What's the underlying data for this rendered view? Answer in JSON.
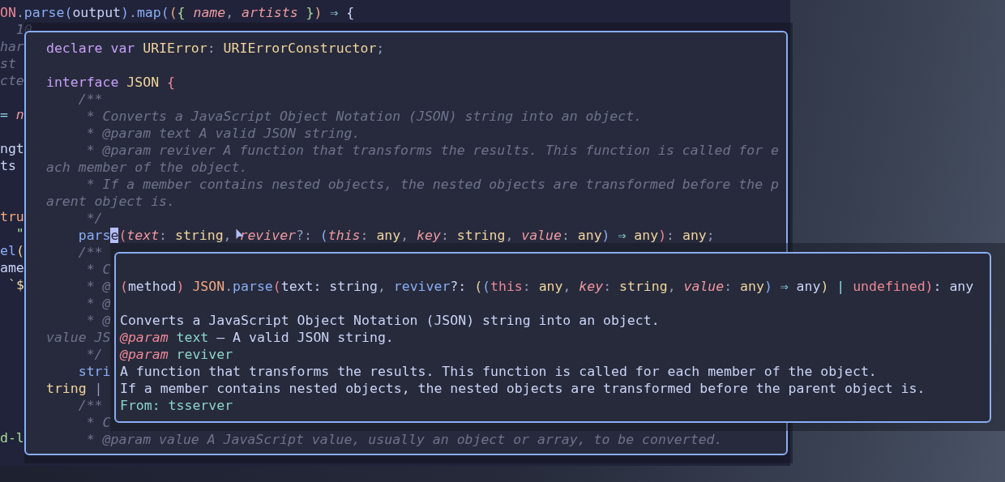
{
  "editor": {
    "lines": [
      {
        "tokens": [
          {
            "kind": "err",
            "text": "ON"
          },
          {
            "kind": "punct",
            "text": "."
          },
          {
            "kind": "fn",
            "text": "parse"
          },
          {
            "kind": "paren",
            "text": "("
          },
          {
            "kind": "text",
            "text": "output"
          },
          {
            "kind": "paren",
            "text": ")"
          },
          {
            "kind": "punct",
            "text": "."
          },
          {
            "kind": "fn",
            "text": "map"
          },
          {
            "kind": "paren",
            "text": "("
          },
          {
            "kind": "peach",
            "text": "("
          },
          {
            "kind": "green",
            "text": "{"
          },
          {
            "kind": "param",
            "text": " name"
          },
          {
            "kind": "punct",
            "text": ","
          },
          {
            "kind": "param",
            "text": " artists"
          },
          {
            "kind": "green",
            "text": " }"
          },
          {
            "kind": "peach",
            "text": ")"
          },
          {
            "kind": "op",
            "text": " ⇒"
          },
          {
            "kind": "text",
            "text": " {"
          }
        ]
      },
      {
        "tokens": [
          {
            "kind": "comment",
            "text": "  10"
          }
        ]
      },
      {
        "tokens": [
          {
            "kind": "comment",
            "text": "har"
          }
        ]
      },
      {
        "tokens": [
          {
            "kind": "comment",
            "text": "st"
          }
        ]
      },
      {
        "tokens": [
          {
            "kind": "comment",
            "text": "cte"
          }
        ]
      },
      {
        "tokens": [
          {
            "kind": "op",
            "text": "="
          },
          {
            "kind": "param",
            "text": " n"
          }
        ]
      },
      {
        "tokens": [
          {
            "kind": "text",
            "text": "ngt"
          }
        ]
      },
      {
        "tokens": [
          {
            "kind": "text",
            "text": "ts"
          }
        ]
      },
      {
        "tokens": [
          {
            "kind": "peach",
            "text": "tru"
          }
        ]
      },
      {
        "tokens": [
          {
            "kind": "green",
            "text": "  \""
          }
        ]
      },
      {
        "tokens": [
          {
            "kind": "fn",
            "text": "el"
          },
          {
            "kind": "type",
            "text": "("
          }
        ]
      },
      {
        "tokens": [
          {
            "kind": "text",
            "text": "ame"
          }
        ]
      },
      {
        "tokens": [
          {
            "kind": "green",
            "text": " `"
          },
          {
            "kind": "type",
            "text": "$"
          }
        ]
      },
      {
        "tokens": [
          {
            "kind": "green",
            "text": "d-l"
          }
        ]
      }
    ]
  },
  "definition_popup": {
    "lines": [
      {
        "tokens": [
          {
            "kind": "kw",
            "text": "declare"
          },
          {
            "kind": "kw",
            "text": " var"
          },
          {
            "kind": "type",
            "text": " URIError"
          },
          {
            "kind": "punct",
            "text": ":"
          },
          {
            "kind": "type",
            "text": " URIErrorConstructor"
          },
          {
            "kind": "punct",
            "text": ";"
          }
        ]
      },
      {
        "tokens": [
          {
            "kind": "kw",
            "text": "interface"
          },
          {
            "kind": "type",
            "text": " JSON"
          },
          {
            "kind": "err",
            "text": " {"
          }
        ]
      },
      {
        "tokens": [
          {
            "kind": "comment",
            "text": "    /**"
          }
        ]
      },
      {
        "tokens": [
          {
            "kind": "comment",
            "text": "     * Converts a JavaScript Object Notation (JSON) string into an object."
          }
        ]
      },
      {
        "tokens": [
          {
            "kind": "comment",
            "text": "     * @param text A valid JSON string."
          }
        ]
      },
      {
        "tokens": [
          {
            "kind": "comment",
            "text": "     * @param reviver A function that transforms the results. This function is called for e"
          }
        ]
      },
      {
        "tokens": [
          {
            "kind": "comment",
            "text": "ach member of the object."
          }
        ]
      },
      {
        "tokens": [
          {
            "kind": "comment",
            "text": "     * If a member contains nested objects, the nested objects are transformed before the p"
          }
        ]
      },
      {
        "tokens": [
          {
            "kind": "comment",
            "text": "arent object is."
          }
        ]
      },
      {
        "tokens": [
          {
            "kind": "comment",
            "text": "     */"
          }
        ]
      },
      {
        "tokens": [
          {
            "kind": "fn",
            "text": "    pars"
          },
          {
            "kind": "cursor",
            "text": "e"
          },
          {
            "kind": "err",
            "text": "("
          },
          {
            "kind": "param",
            "text": "text"
          },
          {
            "kind": "punct",
            "text": ":"
          },
          {
            "kind": "type",
            "text": " string"
          },
          {
            "kind": "punct",
            "text": ","
          },
          {
            "kind": "param",
            "text": " reviver"
          },
          {
            "kind": "punct",
            "text": "?:"
          },
          {
            "kind": "paren",
            "text": " ("
          },
          {
            "kind": "param",
            "text": "this"
          },
          {
            "kind": "punct",
            "text": ":"
          },
          {
            "kind": "type",
            "text": " any"
          },
          {
            "kind": "punct",
            "text": ","
          },
          {
            "kind": "param",
            "text": " key"
          },
          {
            "kind": "punct",
            "text": ":"
          },
          {
            "kind": "type",
            "text": " string"
          },
          {
            "kind": "punct",
            "text": ","
          },
          {
            "kind": "param",
            "text": " value"
          },
          {
            "kind": "punct",
            "text": ":"
          },
          {
            "kind": "type",
            "text": " any"
          },
          {
            "kind": "paren",
            "text": ")"
          },
          {
            "kind": "op",
            "text": " ⇒"
          },
          {
            "kind": "type",
            "text": " any"
          },
          {
            "kind": "err",
            "text": ")"
          },
          {
            "kind": "punct",
            "text": ":"
          },
          {
            "kind": "type",
            "text": " any"
          },
          {
            "kind": "punct",
            "text": ";"
          }
        ]
      },
      {
        "tokens": [
          {
            "kind": "comment",
            "text": "    /**"
          }
        ]
      },
      {
        "tokens": [
          {
            "kind": "comment",
            "text": "     * C"
          }
        ]
      },
      {
        "tokens": [
          {
            "kind": "comment",
            "text": "     * @"
          }
        ]
      },
      {
        "tokens": [
          {
            "kind": "comment",
            "text": "     * @"
          }
        ]
      },
      {
        "tokens": [
          {
            "kind": "comment",
            "text": "     * @"
          }
        ]
      },
      {
        "tokens": [
          {
            "kind": "comment",
            "text": "value JS"
          }
        ]
      },
      {
        "tokens": [
          {
            "kind": "comment",
            "text": "     */"
          }
        ]
      },
      {
        "tokens": [
          {
            "kind": "fn",
            "text": "    stri"
          }
        ]
      },
      {
        "tokens": [
          {
            "kind": "type",
            "text": "tring"
          },
          {
            "kind": "punct",
            "text": " |"
          }
        ]
      },
      {
        "tokens": [
          {
            "kind": "comment",
            "text": "    /**"
          }
        ]
      },
      {
        "tokens": [
          {
            "kind": "comment",
            "text": "     * C"
          }
        ]
      },
      {
        "tokens": [
          {
            "kind": "comment",
            "text": "     * @param value A JavaScript value, usually an object or array, to be converted."
          }
        ]
      }
    ]
  },
  "hover_tooltip": {
    "signature": [
      {
        "kind": "err",
        "text": "("
      },
      {
        "kind": "text",
        "text": "method"
      },
      {
        "kind": "err",
        "text": ")"
      },
      {
        "kind": "peach",
        "text": " JSON"
      },
      {
        "kind": "punct",
        "text": "."
      },
      {
        "kind": "fn",
        "text": "parse"
      },
      {
        "kind": "err",
        "text": "("
      },
      {
        "kind": "text",
        "text": "text: string"
      },
      {
        "kind": "punct",
        "text": ","
      },
      {
        "kind": "fn",
        "text": " reviver"
      },
      {
        "kind": "text",
        "text": "?: "
      },
      {
        "kind": "type",
        "text": "("
      },
      {
        "kind": "paren",
        "text": "("
      },
      {
        "kind": "err",
        "text": "this"
      },
      {
        "kind": "punct",
        "text": ":"
      },
      {
        "kind": "type",
        "text": " any"
      },
      {
        "kind": "punct",
        "text": ","
      },
      {
        "kind": "param",
        "text": " key"
      },
      {
        "kind": "punct",
        "text": ":"
      },
      {
        "kind": "type",
        "text": " string"
      },
      {
        "kind": "punct",
        "text": ","
      },
      {
        "kind": "param",
        "text": " value"
      },
      {
        "kind": "punct",
        "text": ":"
      },
      {
        "kind": "type",
        "text": " any"
      },
      {
        "kind": "paren",
        "text": ")"
      },
      {
        "kind": "op",
        "text": " ⇒"
      },
      {
        "kind": "text",
        "text": " any"
      },
      {
        "kind": "type",
        "text": ")"
      },
      {
        "kind": "op",
        "text": " |"
      },
      {
        "kind": "err",
        "text": " undefined"
      },
      {
        "kind": "err",
        "text": ")"
      },
      {
        "kind": "text",
        "text": ": any"
      }
    ],
    "doc": [
      {
        "tokens": [
          {
            "kind": "text",
            "text": "Converts a JavaScript Object Notation (JSON) string into an object."
          }
        ]
      },
      {
        "tokens": [
          {
            "kind": "tag",
            "text": "@param"
          },
          {
            "kind": "teal",
            "text": " text"
          },
          {
            "kind": "text",
            "text": " — A valid JSON string."
          }
        ]
      },
      {
        "tokens": [
          {
            "kind": "tag",
            "text": "@param"
          },
          {
            "kind": "teal",
            "text": " reviver"
          }
        ]
      },
      {
        "tokens": [
          {
            "kind": "text",
            "text": "A function that transforms the results. This function is called for each member of the object."
          }
        ]
      },
      {
        "tokens": [
          {
            "kind": "text",
            "text": "If a member contains nested objects, the nested objects are transformed before the parent object is."
          }
        ]
      },
      {
        "tokens": [
          {
            "kind": "teal",
            "text": "From: tsserver"
          }
        ]
      }
    ]
  }
}
